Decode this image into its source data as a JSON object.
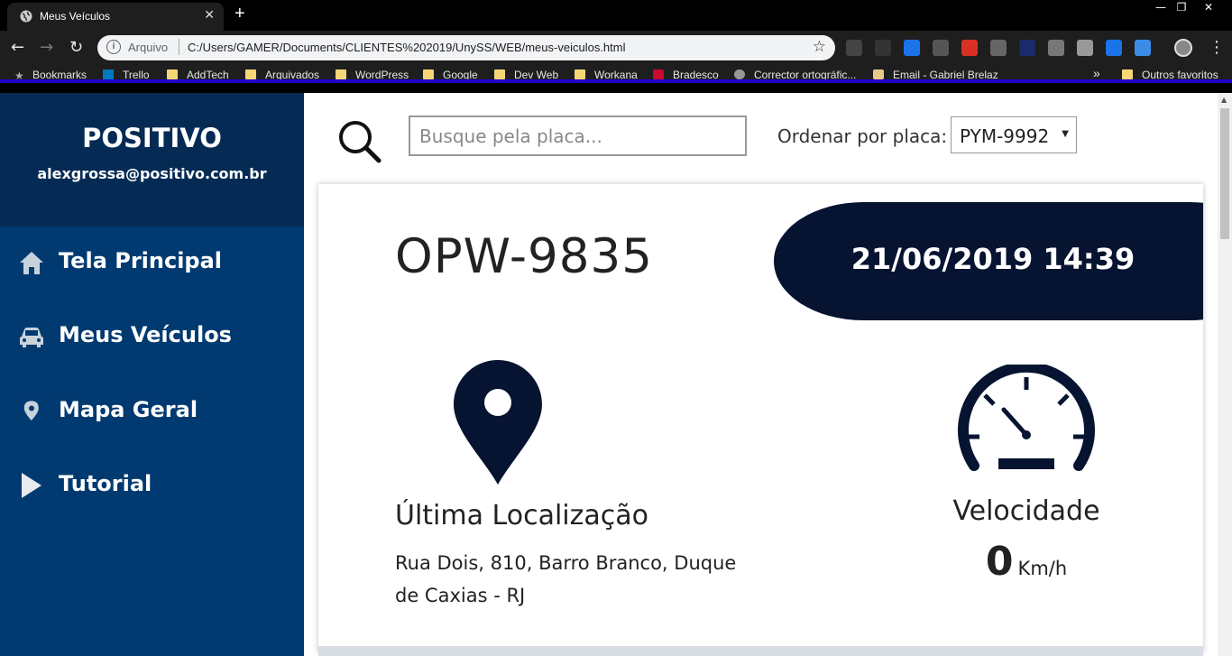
{
  "browser": {
    "tab_title": "Meus Veículos",
    "tab_close": "✕",
    "new_tab": "+",
    "window_controls": {
      "minimize": "—",
      "restore": "❐",
      "close": "✕"
    },
    "nav": {
      "back": "←",
      "forward": "→",
      "reload": "↻"
    },
    "address": {
      "info_icon": "i",
      "scheme": "Arquivo",
      "url": "C:/Users/GAMER/Documents/CLIENTES%202019/UnySS/WEB/meus-veiculos.html",
      "star": "☆"
    },
    "menu": "⋮",
    "bookmarks": [
      {
        "label": "Bookmarks",
        "icon": "star-icon"
      },
      {
        "label": "Trello",
        "icon": "trello-icon"
      },
      {
        "label": "AddTech",
        "icon": "folder-icon"
      },
      {
        "label": "Arquivados",
        "icon": "folder-icon"
      },
      {
        "label": "WordPress",
        "icon": "folder-icon"
      },
      {
        "label": "Google",
        "icon": "folder-icon"
      },
      {
        "label": "Dev Web",
        "icon": "folder-icon"
      },
      {
        "label": "Workana",
        "icon": "folder-icon"
      },
      {
        "label": "Bradesco",
        "icon": "bradesco-icon"
      },
      {
        "label": "Corrector ortográfic...",
        "icon": "globe-icon"
      },
      {
        "label": "Email - Gabriel Brelaz",
        "icon": "email-icon"
      }
    ],
    "more_bookmarks": "»",
    "other_bookmarks": "Outros favoritos"
  },
  "sidebar": {
    "company": "POSITIVO",
    "email": "alexgrossa@positivo.com.br",
    "items": [
      {
        "label": "Tela Principal",
        "icon": "home-icon"
      },
      {
        "label": "Meus Veículos",
        "icon": "car-icon"
      },
      {
        "label": "Mapa Geral",
        "icon": "map-pin-icon"
      },
      {
        "label": "Tutorial",
        "icon": "play-icon"
      }
    ]
  },
  "search": {
    "placeholder": "Busque pela placa..."
  },
  "sort": {
    "label": "Ordenar por placa:",
    "selected": "PYM-9992",
    "arrow": "▼"
  },
  "vehicle": {
    "plate": "OPW-9835",
    "datetime": "21/06/2019 14:39",
    "location_title": "Última Localização",
    "location_address": "Rua Dois, 810, Barro Branco, Duque de Caxias - RJ",
    "speed_title": "Velocidade",
    "speed_value": "0",
    "speed_unit": "Km/h"
  },
  "colors": {
    "sidebar": "#003a70",
    "sidebar_header": "#052b55",
    "accent_dark": "#061331",
    "icon_dark": "#061331"
  }
}
